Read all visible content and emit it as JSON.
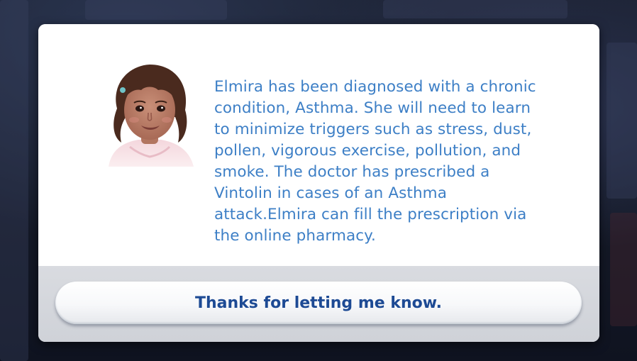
{
  "notification": {
    "sim_name": "Elmira",
    "message": "Elmira has been diagnosed with a chronic\ncondition, Asthma. She will need to learn\nto minimize triggers such as stress, dust,\npollen, vigorous exercise, pollution, and\nsmoke. The doctor has prescribed a\nVintolin in cases of an Asthma\nattack.Elmira can fill the prescription via\nthe online pharmacy.",
    "portrait_icon": "sim-portrait-child-girl",
    "button_label": "Thanks for letting me know."
  },
  "colors": {
    "message_text": "#3d7fc6",
    "button_text": "#1d4a94",
    "dialog_background": "#ffffff",
    "footer_background": "#d4d6dc"
  }
}
